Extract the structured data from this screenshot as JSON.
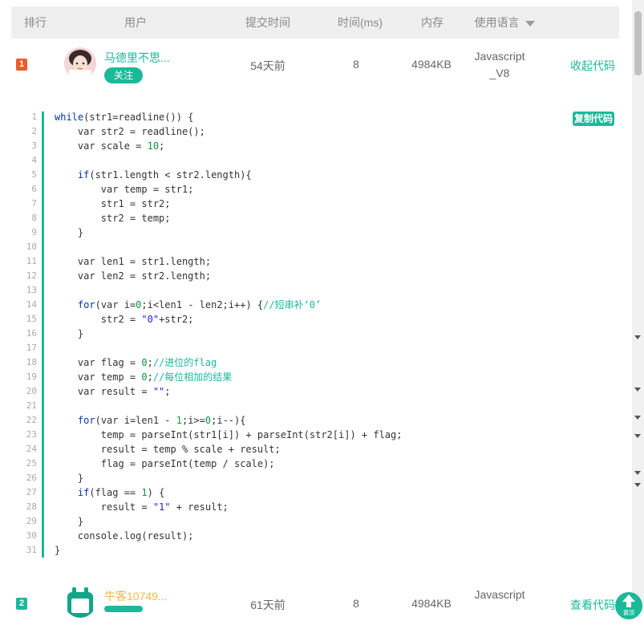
{
  "header": {
    "rank": "排行",
    "user": "用户",
    "submit_time": "提交时间",
    "time_ms": "时间(ms)",
    "memory": "内存",
    "language": "使用语言"
  },
  "rows": [
    {
      "rank": "1",
      "rank_color": "#f05a2b",
      "username": "马德里不思...",
      "username_color": "#1bb99a",
      "follow": "关注",
      "submit": "54天前",
      "time": "8",
      "memory": "4984KB",
      "lang1": "Javascript",
      "lang2": "_V8",
      "action": "收起代码"
    },
    {
      "rank": "2",
      "rank_color": "#1bb99a",
      "username": "牛客10749...",
      "username_color": "#f0b84b",
      "submit": "61天前",
      "time": "8",
      "memory": "4984KB",
      "lang1": "Javascript",
      "action": "查看代码"
    }
  ],
  "code": {
    "copy_label": "复制代码",
    "line_numbers": [
      "1",
      "2",
      "3",
      "4",
      "5",
      "6",
      "7",
      "8",
      "9",
      "10",
      "11",
      "12",
      "13",
      "14",
      "15",
      "16",
      "17",
      "18",
      "19",
      "20",
      "21",
      "22",
      "23",
      "24",
      "25",
      "26",
      "27",
      "28",
      "29",
      "30",
      "31"
    ],
    "lines": [
      "while(str1=readline()) {",
      "    var str2 = readline();",
      "    var scale = 10;",
      "",
      "    if(str1.length < str2.length){",
      "        var temp = str1;",
      "        str1 = str2;",
      "        str2 = temp;",
      "    }",
      "",
      "    var len1 = str1.length;",
      "    var len2 = str2.length;",
      "",
      "    for(var i=0;i<len1 - len2;i++) {//短串补‘0’",
      "        str2 = \"0\"+str2;",
      "    }",
      "",
      "    var flag = 0;//进位的flag",
      "    var temp = 0;//每位相加的结果",
      "    var result = \"\";",
      "",
      "    for(var i=len1 - 1;i>=0;i--){",
      "        temp = parseInt(str1[i]) + parseInt(str2[i]) + flag;",
      "        result = temp % scale + result;",
      "        flag = parseInt(temp / scale);",
      "    }",
      "    if(flag == 1) {",
      "        result = \"1\" + result;",
      "    }",
      "    console.log(result);",
      "}"
    ]
  },
  "totop_label": "置顶",
  "colors": {
    "accent": "#1bb99a",
    "header_bg": "#efefef"
  }
}
